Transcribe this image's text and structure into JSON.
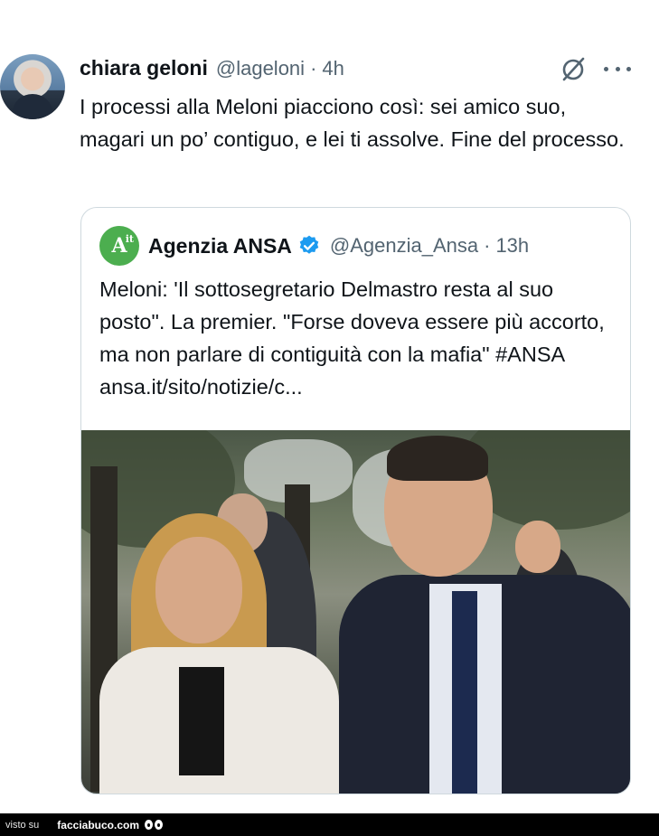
{
  "tweet": {
    "author_name": "chiara geloni",
    "author_handle": "@lageloni",
    "separator": "·",
    "time": "4h",
    "text": "I processi alla Meloni piacciono così: sei amico suo, magari un po’ contiguo, e lei ti assolve. Fine del processo."
  },
  "quoted_tweet": {
    "logo_text": "A",
    "logo_superscript": "it",
    "author_name": "Agenzia ANSA",
    "author_handle": "@Agenzia_Ansa",
    "separator": "·",
    "time": "13h",
    "text": "Meloni: 'Il sottosegretario Delmastro resta al suo posto\". La premier. \"Forse doveva essere più accorto, ma non parlare di contiguità con la mafia\" #ANSA ansa.it/sito/notizie/c..."
  },
  "footer": {
    "visto_su": "visto su",
    "site": "facciabuco.com"
  },
  "colors": {
    "text": "#0f1419",
    "secondary": "#536471",
    "border": "#cfd9de",
    "verified": "#1d9bf0",
    "ansa_green": "#4cae4f"
  },
  "icons": [
    "grok-icon",
    "more-icon",
    "verified-badge-icon",
    "facciabuco-eyes-icon"
  ]
}
